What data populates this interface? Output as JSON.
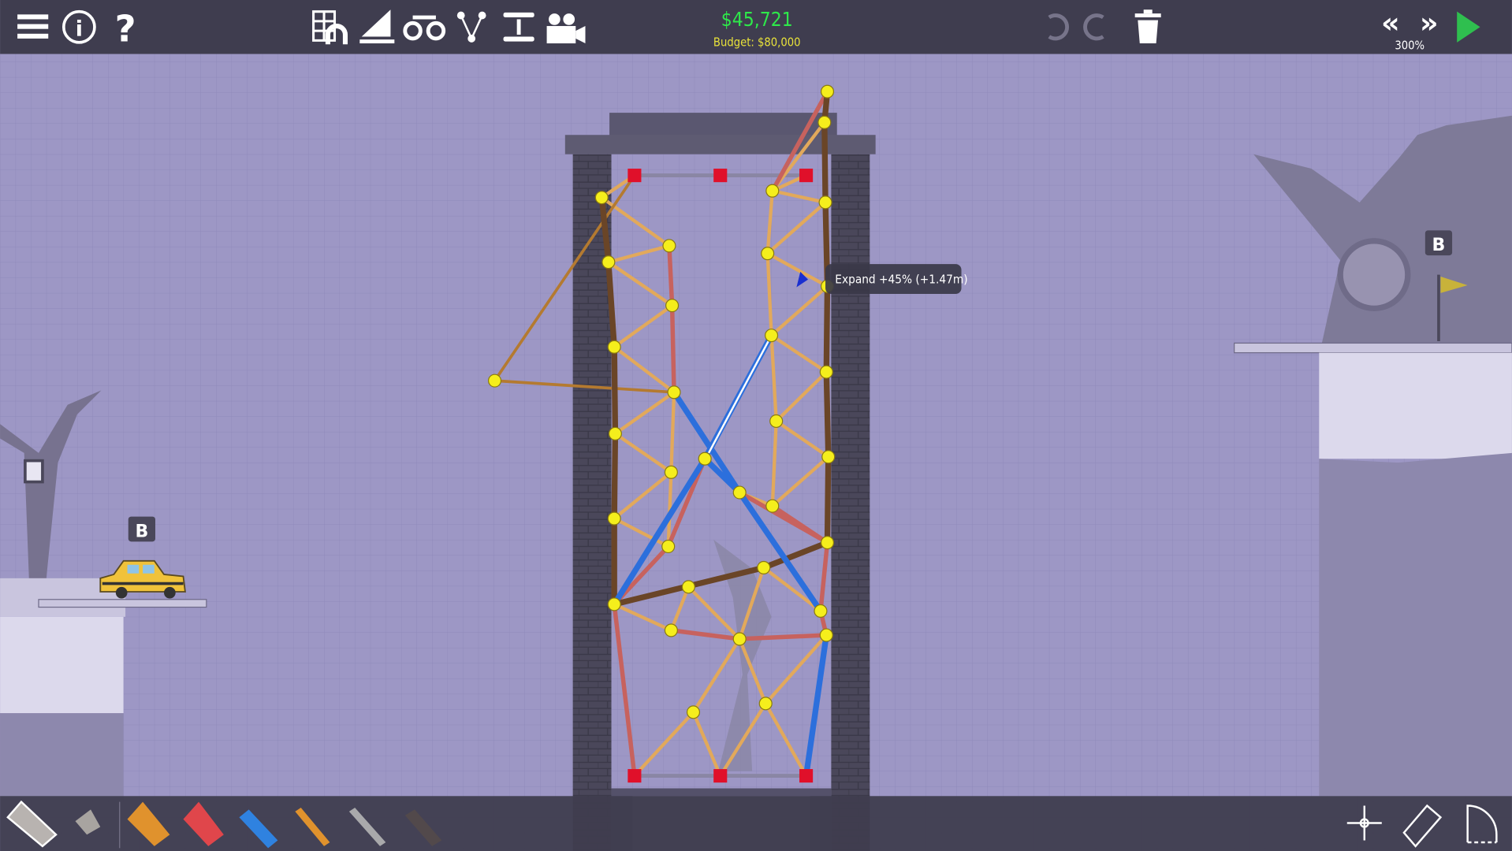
{
  "topbar": {
    "cost": "$45,721",
    "budget": "Budget: $80,000",
    "sim_speed": "300%",
    "icons": [
      "menu-icon",
      "info-icon",
      "help-icon",
      "grid-arch-icon",
      "slope-icon",
      "binoculars-icon",
      "joints-icon",
      "split-icon",
      "camera-icon",
      "undo-icon",
      "redo-icon",
      "trash-icon",
      "rewind-icon",
      "fast-forward-icon",
      "play-icon"
    ]
  },
  "tooltip": "Expand +45% (+1.47m)",
  "checkpoints": {
    "left": "B",
    "right": "B"
  },
  "materials": [
    "road",
    "reinforced-road",
    "wood",
    "steel",
    "hydraulic",
    "rope",
    "cable",
    "spring"
  ],
  "right_tools": [
    "move-icon",
    "eraser-icon",
    "arc-icon"
  ],
  "colors": {
    "wood": "#e2a95b",
    "steel": "#6a4527",
    "road": "#c7625e",
    "hydraulic": "#2c6fdc",
    "cost": "#2ee84a",
    "budget": "#e8e23a",
    "background": "#9d97c5",
    "bar": "#3f3d4f"
  }
}
